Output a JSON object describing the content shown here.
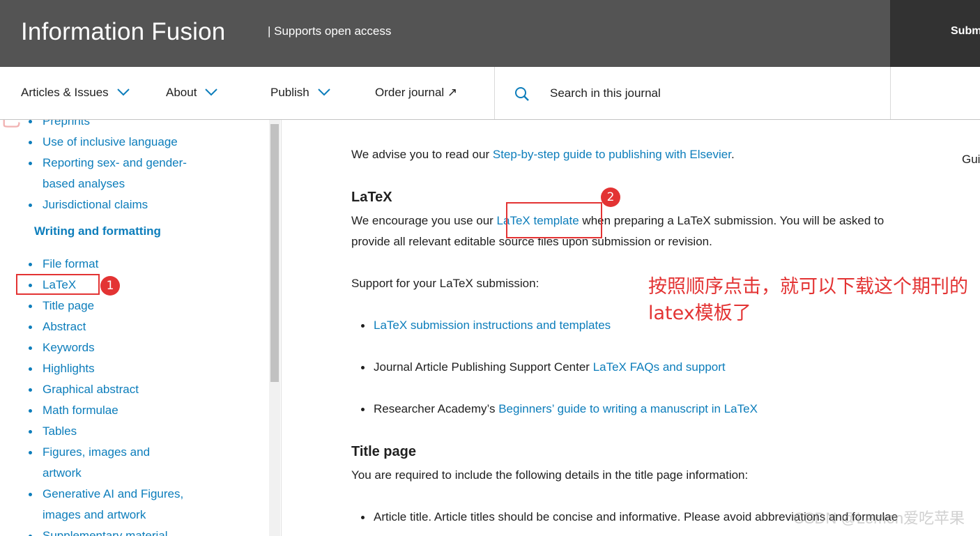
{
  "header": {
    "journal_title": "Information Fusion",
    "open_access": "| Supports open access",
    "submit_label": "Subm"
  },
  "nav": {
    "articles": "Articles & Issues",
    "about": "About",
    "publish": "Publish",
    "order": "Order journal ↗",
    "search_placeholder": "Search in this journal",
    "guide": "Gui"
  },
  "sidebar": {
    "items_top": [
      "Preprints",
      "Use of inclusive language",
      "Reporting sex- and gender-",
      "based analyses",
      "Jurisdictional claims"
    ],
    "heading": "Writing and formatting",
    "items": [
      "File format",
      "LaTeX",
      "Title page",
      "Abstract",
      "Keywords",
      "Highlights",
      "Graphical abstract",
      "Math formulae",
      "Tables",
      "Figures, images and",
      "artwork",
      "Generative AI and Figures,",
      "images and artwork",
      "Supplementary material"
    ]
  },
  "main": {
    "advise_prefix": "We advise you to read our ",
    "advise_link": "Step-by-step guide to publishing with Elsevier",
    "advise_suffix": ".",
    "latex_heading": "LaTeX",
    "latex_prefix": "We encourage you use our ",
    "latex_link": "LaTeX template",
    "latex_suffix": " when preparing a LaTeX submission. You will be asked to",
    "latex_line2": "provide all relevant editable source files upon submission or revision.",
    "support_text": "Support for your LaTeX submission:",
    "bullet1_link": "LaTeX submission instructions and templates",
    "bullet2_prefix": "Journal Article Publishing Support Center ",
    "bullet2_link": "LaTeX FAQs and support",
    "bullet3_prefix": "Researcher Academy’s ",
    "bullet3_link": "Beginners’ guide to writing a manuscript in LaTeX",
    "title_heading": "Title page",
    "title_text": "You are required to include the following details in the title page information:",
    "article_title_bullet": "Article title. Article titles should be concise and informative. Please avoid abbreviations and formulae"
  },
  "annotations": {
    "badge1": "1",
    "badge2": "2",
    "note": "按照顺序点击，就可以下载这个期刊的latex模板了",
    "watermark": "CSDN @Lemon爱吃苹果"
  },
  "colors": {
    "link": "#0c7dbb",
    "header_bg": "#545454",
    "annotation": "#e33333"
  },
  "icons": [
    "chevron-down-icon",
    "external-arrow-icon",
    "search-icon"
  ]
}
